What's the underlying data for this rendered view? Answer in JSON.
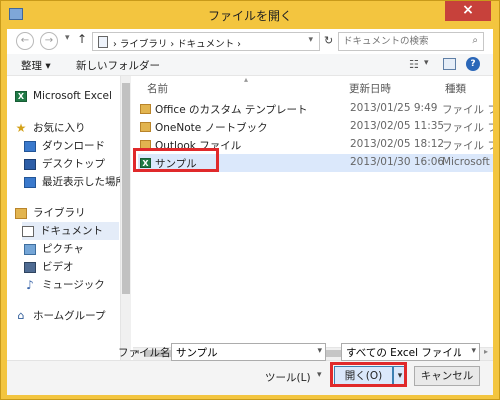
{
  "window": {
    "title": "ファイルを開く",
    "close_label": "×"
  },
  "navigation": {
    "back_glyph": "←",
    "forward_glyph": "→",
    "up_glyph": "↑",
    "address": "› ライブラリ › ドキュメント ›",
    "refresh_glyph": "↻",
    "search_placeholder": "ドキュメントの検索"
  },
  "toolbar": {
    "organize": "整理 ▾",
    "new_folder": "新しいフォルダー",
    "help": "?"
  },
  "sidebar": {
    "items": [
      {
        "label": "Microsoft Excel"
      },
      {
        "label": "お気に入り"
      },
      {
        "label": "ダウンロード"
      },
      {
        "label": "デスクトップ"
      },
      {
        "label": "最近表示した場所"
      },
      {
        "label": "ライブラリ"
      },
      {
        "label": "ドキュメント"
      },
      {
        "label": "ピクチャ"
      },
      {
        "label": "ビデオ"
      },
      {
        "label": "ミュージック"
      },
      {
        "label": "ホームグループ"
      }
    ]
  },
  "file_list": {
    "columns": {
      "name": "名前",
      "modified": "更新日時",
      "type": "種類"
    },
    "files": [
      {
        "name": "Office のカスタム テンプレート",
        "modified": "2013/01/25 9:49",
        "type": "ファイル フォル"
      },
      {
        "name": "OneNote ノートブック",
        "modified": "2013/02/05 11:35",
        "type": "ファイル フォル"
      },
      {
        "name": "Outlook ファイル",
        "modified": "2013/02/05 18:12",
        "type": "ファイル フォル"
      },
      {
        "name": "サンプル",
        "modified": "2013/01/30 16:06",
        "type": "Microsoft Ex"
      }
    ]
  },
  "footer": {
    "filename_label": "ファイル名(N):",
    "filename_value": "サンプル",
    "filetype_value": "すべての Excel ファイル",
    "tools_label": "ツール(L)",
    "open_label": "開く(O)",
    "cancel_label": "キャンセル"
  },
  "colors": {
    "title_bar": "#f3c53f",
    "close_button": "#c7413b",
    "highlight_box": "#e0292b",
    "selected_row": "#dbe8fb"
  }
}
